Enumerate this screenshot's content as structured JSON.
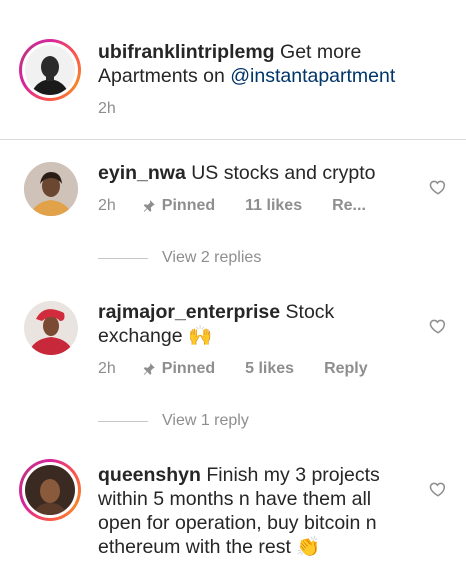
{
  "caption": {
    "username": "ubifranklintriplemg",
    "text": "Get more Apartments on ",
    "mention": "@instantapartment",
    "time": "2h"
  },
  "comments": [
    {
      "username": "eyin_nwa",
      "text": "US stocks and crypto",
      "time": "2h",
      "pinned": "Pinned",
      "likes": "11 likes",
      "reply": "Re...",
      "view_replies": "View 2 replies"
    },
    {
      "username": "rajmajor_enterprise",
      "text": "Stock exchange",
      "emoji": "🙌",
      "time": "2h",
      "pinned": "Pinned",
      "likes": "5 likes",
      "reply": "Reply",
      "view_replies": "View 1 reply"
    },
    {
      "username": "queenshyn",
      "text": "Finish my 3 projects within 5 months n have them all open for operation, buy bitcoin n ethereum with the rest",
      "emoji": "👏"
    }
  ],
  "icons": {
    "heart": "heart-outline-icon",
    "pin": "pin-icon"
  },
  "colors": {
    "mention": "#003569",
    "text": "#262626",
    "secondary": "#8e8e8e",
    "divider": "#dbdbdb"
  }
}
